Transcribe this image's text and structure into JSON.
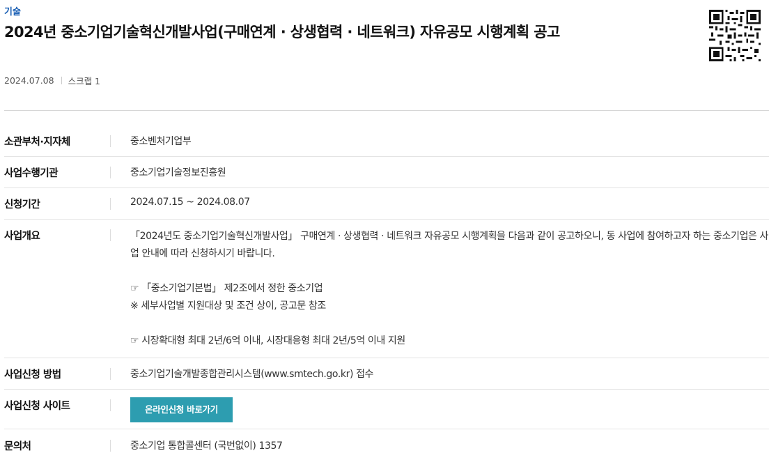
{
  "header": {
    "category": "기술",
    "title": "2024년 중소기업기술혁신개발사업(구매연계 · 상생협력 · 네트워크) 자유공모 시행계획 공고",
    "date": "2024.07.08",
    "scrap": "스크랩 1"
  },
  "info": {
    "rows": [
      {
        "label": "소관부처·지자체",
        "value": "중소벤처기업부"
      },
      {
        "label": "사업수행기관",
        "value": "중소기업기술정보진흥원"
      },
      {
        "label": "신청기간",
        "value": "2024.07.15 ~ 2024.08.07"
      },
      {
        "label": "사업개요",
        "lines": [
          "「2024년도 중소기업기술혁신개발사업」 구매연계 · 상생협력 · 네트워크 자유공모 시행계획을 다음과 같이 공고하오니, 동 사업에 참여하고자 하는 중소기업은 사업 안내에 따라 신청하시기 바랍니다.",
          "",
          "☞ 「중소기업기본법」 제2조에서 정한 중소기업",
          "※ 세부사업별 지원대상 및 조건 상이, 공고문 참조",
          "",
          "☞ 시장확대형 최대 2년/6억 이내, 시장대응형 최대 2년/5억 이내 지원"
        ]
      },
      {
        "label": "사업신청 방법",
        "value": "중소기업기술개발종합관리시스템(www.smtech.go.kr) 접수"
      },
      {
        "label": "사업신청 사이트",
        "button": "온라인신청 바로가기"
      },
      {
        "label": "문의처",
        "value": "중소기업 통합콜센터 (국번없이) 1357"
      }
    ]
  },
  "colors": {
    "category": "#1a5fb4",
    "button_bg": "#2d9db0",
    "button_text": "#ffffff"
  },
  "icons": {
    "qr": "qr-code-icon"
  }
}
